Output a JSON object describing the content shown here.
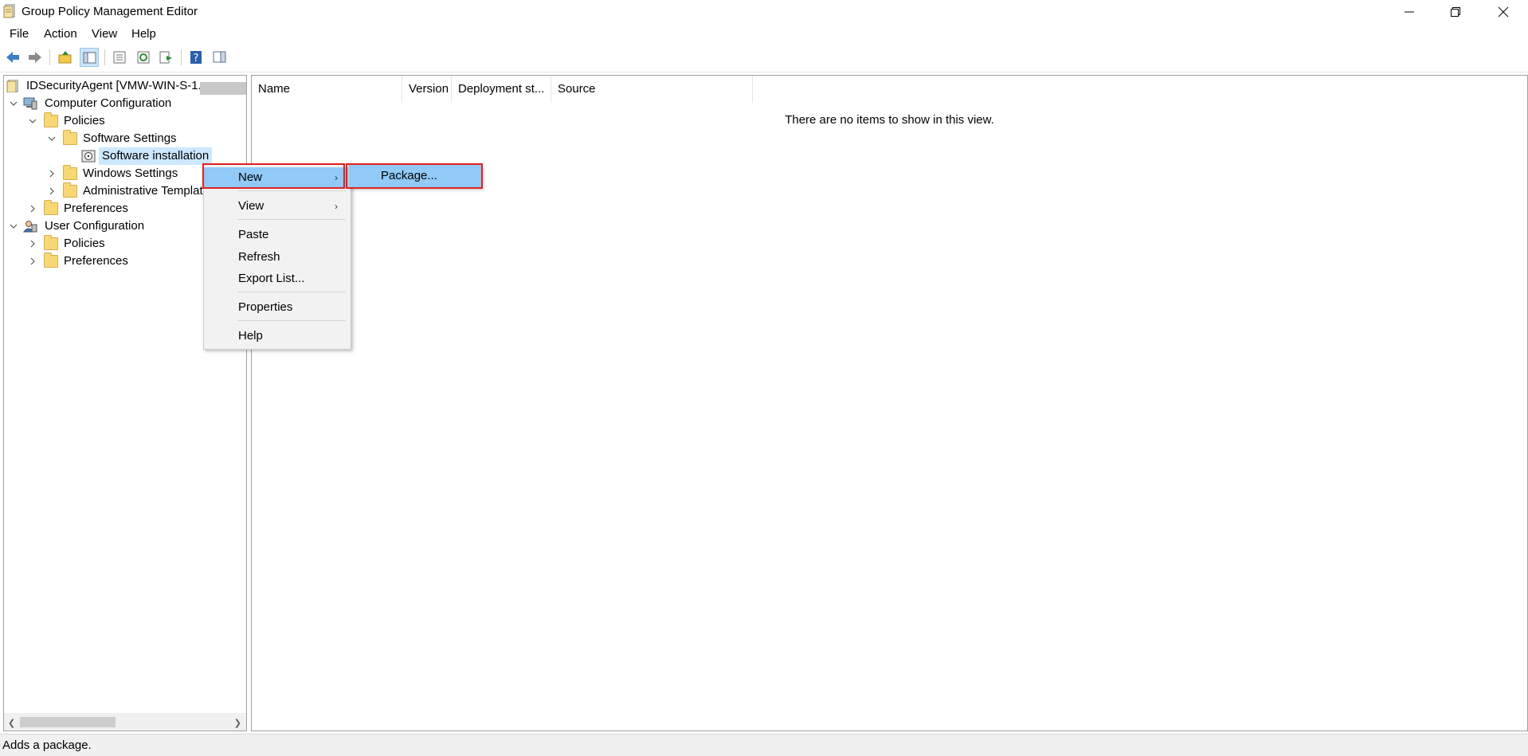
{
  "window": {
    "title": "Group Policy Management Editor"
  },
  "menubar": {
    "items": [
      "File",
      "Action",
      "View",
      "Help"
    ]
  },
  "tree": {
    "root_label": "IDSecurityAgent [VMW-WIN-S-1.",
    "nodes": [
      {
        "label": "Computer Configuration"
      },
      {
        "label": "Policies"
      },
      {
        "label": "Software Settings"
      },
      {
        "label": "Software installation"
      },
      {
        "label": "Windows Settings"
      },
      {
        "label": "Administrative Templates"
      },
      {
        "label": "Preferences"
      },
      {
        "label": "User Configuration"
      },
      {
        "label": "Policies"
      },
      {
        "label": "Preferences"
      }
    ]
  },
  "list": {
    "columns": [
      "Name",
      "Version",
      "Deployment st...",
      "Source"
    ],
    "empty_message": "There are no items to show in this view."
  },
  "context_menu": {
    "items": [
      "New",
      "View",
      "Paste",
      "Refresh",
      "Export List...",
      "Properties",
      "Help"
    ],
    "submenu_item": "Package..."
  },
  "status": {
    "text": "Adds a package."
  },
  "colors": {
    "highlight": "#91c9f7",
    "selection": "#cce8ff",
    "callout": "#e02020"
  }
}
